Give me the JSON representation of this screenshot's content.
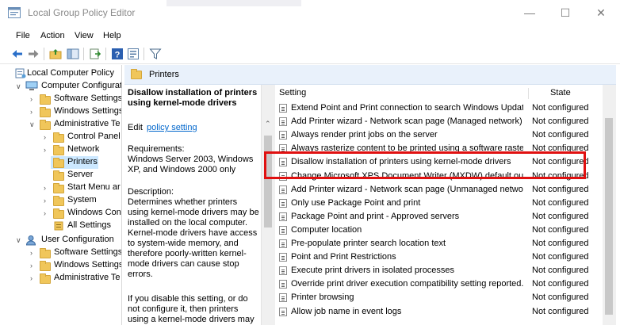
{
  "window": {
    "title": "Local Group Policy Editor",
    "minimize": "—",
    "maximize": "☐",
    "close": "✕"
  },
  "menu": [
    "File",
    "Action",
    "View",
    "Help"
  ],
  "tree": {
    "items": [
      {
        "label": "Local Computer Policy"
      },
      {
        "label": "Computer Configurati"
      },
      {
        "label": "Software Settings"
      },
      {
        "label": "Windows Settings"
      },
      {
        "label": "Administrative Te"
      },
      {
        "label": "Control Panel"
      },
      {
        "label": "Network"
      },
      {
        "label": "Printers"
      },
      {
        "label": "Server"
      },
      {
        "label": "Start Menu ar"
      },
      {
        "label": "System"
      },
      {
        "label": "Windows Con"
      },
      {
        "label": "All Settings"
      },
      {
        "label": "User Configuration"
      },
      {
        "label": "Software Settings"
      },
      {
        "label": "Windows Settings"
      },
      {
        "label": "Administrative Te"
      }
    ]
  },
  "pane": {
    "title": "Printers"
  },
  "description": {
    "heading": "Disallow installation of printers using kernel-mode drivers",
    "edit_prefix": "Edit",
    "edit_link": "policy setting",
    "requirements_label": "Requirements:",
    "requirements": "Windows Server 2003, Windows XP, and Windows 2000 only",
    "description_label": "Description:",
    "description": "Determines whether printers using kernel-mode drivers may be installed on the local computer. Kernel-mode drivers have access to system-wide memory, and therefore poorly-written kernel-mode drivers can cause stop errors.",
    "more": "If you disable this setting, or do not configure it, then printers using a kernel-mode drivers may"
  },
  "list": {
    "col_setting": "Setting",
    "col_state": "State",
    "rows": [
      {
        "setting": "Extend Point and Print connection to search Windows Update",
        "state": "Not configured"
      },
      {
        "setting": "Add Printer wizard - Network scan page (Managed network)",
        "state": "Not configured"
      },
      {
        "setting": "Always render print jobs on the server",
        "state": "Not configured"
      },
      {
        "setting": "Always rasterize content to be printed using a software rasteri",
        "state": "Not configured"
      },
      {
        "setting": "Disallow installation of printers using kernel-mode drivers",
        "state": "Not configured"
      },
      {
        "setting": "Change Microsoft XPS Document Writer (MXDW) default out",
        "state": "Not configured"
      },
      {
        "setting": "Add Printer wizard - Network scan page (Unmanaged network)",
        "state": "Not configured"
      },
      {
        "setting": "Only use Package Point and print",
        "state": "Not configured"
      },
      {
        "setting": "Package Point and print - Approved servers",
        "state": "Not configured"
      },
      {
        "setting": "Computer location",
        "state": "Not configured"
      },
      {
        "setting": "Pre-populate printer search location text",
        "state": "Not configured"
      },
      {
        "setting": "Point and Print Restrictions",
        "state": "Not configured"
      },
      {
        "setting": "Execute print drivers in isolated processes",
        "state": "Not configured"
      },
      {
        "setting": "Override print driver execution compatibility setting reported...",
        "state": "Not configured"
      },
      {
        "setting": "Printer browsing",
        "state": "Not configured"
      },
      {
        "setting": "Allow job name in event logs",
        "state": "Not configured"
      }
    ]
  },
  "colors": {
    "selection": "#cce8ff",
    "highlight_box": "#e01010",
    "link": "#0066cc",
    "header_bg": "#e9f1fb"
  }
}
